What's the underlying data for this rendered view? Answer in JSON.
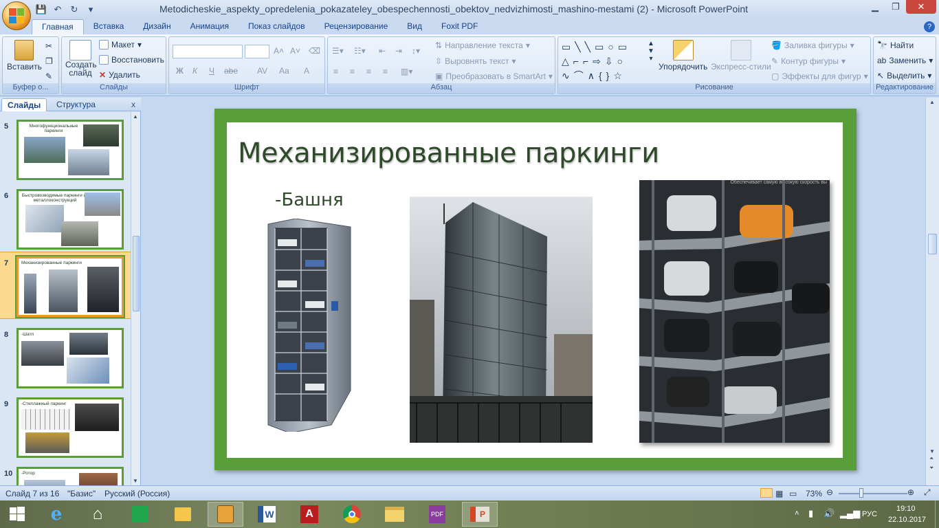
{
  "window": {
    "title": "Metodicheskie_aspekty_opredelenia_pokazateley_obespechennosti_obektov_nedvizhimosti_mashino-mestami (2) - Microsoft PowerPoint"
  },
  "ribbon_tabs": [
    "Главная",
    "Вставка",
    "Дизайн",
    "Анимация",
    "Показ слайдов",
    "Рецензирование",
    "Вид",
    "Foxit PDF"
  ],
  "ribbon": {
    "clipboard": {
      "paste": "Вставить",
      "group": "Буфер о..."
    },
    "slides": {
      "new_slide": "Создать слайд",
      "layout": "Макет",
      "reset": "Восстановить",
      "delete": "Удалить",
      "group": "Слайды"
    },
    "font": {
      "group": "Шрифт",
      "bold": "Ж",
      "italic": "К",
      "underline": "Ч",
      "strike": "abe",
      "spacing": "AV",
      "case": "Aa",
      "color": "A"
    },
    "paragraph": {
      "text_direction": "Направление текста",
      "align_text": "Выровнять текст",
      "smartart": "Преобразовать в SmartArt",
      "group": "Абзац"
    },
    "drawing": {
      "arrange": "Упорядочить",
      "quick_styles": "Экспресс-стили",
      "fill": "Заливка фигуры",
      "outline": "Контур фигуры",
      "effects": "Эффекты для фигур",
      "group": "Рисование"
    },
    "editing": {
      "find": "Найти",
      "replace": "Заменить",
      "select": "Выделить",
      "group": "Редактирование"
    }
  },
  "pane": {
    "tab_slides": "Слайды",
    "tab_outline": "Структура",
    "close": "x",
    "thumbnails": [
      {
        "num": "5",
        "title": "Многофункциональные паркинги"
      },
      {
        "num": "6",
        "title": "Быстровозводимые паркинги из металлоконструкций"
      },
      {
        "num": "7",
        "title": "Механизированные паркинги"
      },
      {
        "num": "8",
        "title": "-Шатл"
      },
      {
        "num": "9",
        "title": "-Стеллажный паркинг"
      },
      {
        "num": "10",
        "title": "-Ротор"
      }
    ]
  },
  "slide": {
    "title": "Механизированные паркинги",
    "subtitle": "-Башня",
    "photo_caption": "Обеспечивает самую высокую скорость вы"
  },
  "statusbar": {
    "slide_pos": "Слайд 7 из 16",
    "theme": "\"Базис\"",
    "language": "Русский (Россия)",
    "zoom": "73%"
  },
  "taskbar": {
    "lang": "РУС",
    "time": "19:10",
    "date": "22.10.2017"
  },
  "colors": {
    "slide_border": "#5a9e3a",
    "title_text": "#2f4a2a",
    "selected_thumb": "#fbd98e"
  }
}
